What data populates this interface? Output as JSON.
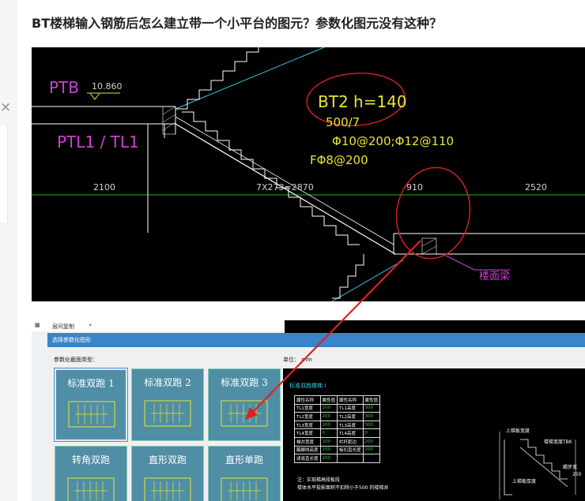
{
  "question": {
    "title": "BT楼梯输入钢筋后怎么建立带一个小平台的图元？参数化图元没有这种？"
  },
  "left_panel": {
    "close_glyph": "×"
  },
  "cad_drawing": {
    "label_ptb": "PTB",
    "label_elev": "10.860",
    "label_beams": "PTL1 / TL1",
    "label_annot1": "BT2 h=140",
    "label_annot2": "500/7",
    "label_annot3": "Φ10@200;Φ12@110",
    "label_annot4": "FΦ8@200",
    "dim_2100": "2100",
    "dim_steps": "7X273=2870",
    "dim_910": "910",
    "dim_2520": "2520",
    "label_beam": "楼面梁",
    "colors": {
      "annot": "#e6e633",
      "dim": "#d0d0d0",
      "stroke": "#ffffff",
      "red": "#d02020",
      "pink": "#d040d0",
      "cyan": "#33c8e0",
      "green": "#1db31d"
    }
  },
  "software": {
    "toolbar_text": "层间复制",
    "toolbar_more": "»",
    "dialog_title": "选择参数化图形",
    "type_label": "参数化截面类型：",
    "unit_label": "单位： mm",
    "tiles": [
      {
        "name": "标准双跑 1",
        "selected": true
      },
      {
        "name": "标准双跑 2",
        "selected": false
      },
      {
        "name": "标准双跑 3",
        "selected": false
      },
      {
        "name": "转角双跑",
        "selected": false
      },
      {
        "name": "直形双跑",
        "selected": false
      },
      {
        "name": "直形单跑",
        "selected": false
      }
    ],
    "preview": {
      "title": "标准双跑楼梯 I",
      "headers": [
        "属性名称",
        "属性值",
        "属性名称",
        "属性值"
      ],
      "rows": [
        [
          "TL1宽度",
          "200",
          "TL1高度",
          "300"
        ],
        [
          "TL2宽度",
          "200",
          "TL2高度",
          "300"
        ],
        [
          "TL3宽度",
          "200",
          "TL3高度",
          "300"
        ],
        [
          "TL4宽度",
          "0",
          "TL4高度",
          "0"
        ],
        [
          "梯井宽度",
          "100",
          "栏杆距边",
          "200"
        ],
        [
          "踢脚线高度",
          "150",
          "板扣直长度",
          "200"
        ],
        [
          "滤液直长度",
          "200",
          "",
          ""
        ]
      ],
      "note1": "注：实现梯高段板段",
      "note2": "楼体水平投影面积不扣除小于500 的楼梯井",
      "label_top": "上梯板宽度",
      "label_right": "楼梯宽度TBK",
      "label_bottom": "上梯板厚度",
      "label_step": "踢步宽",
      "label_num": "250"
    }
  }
}
